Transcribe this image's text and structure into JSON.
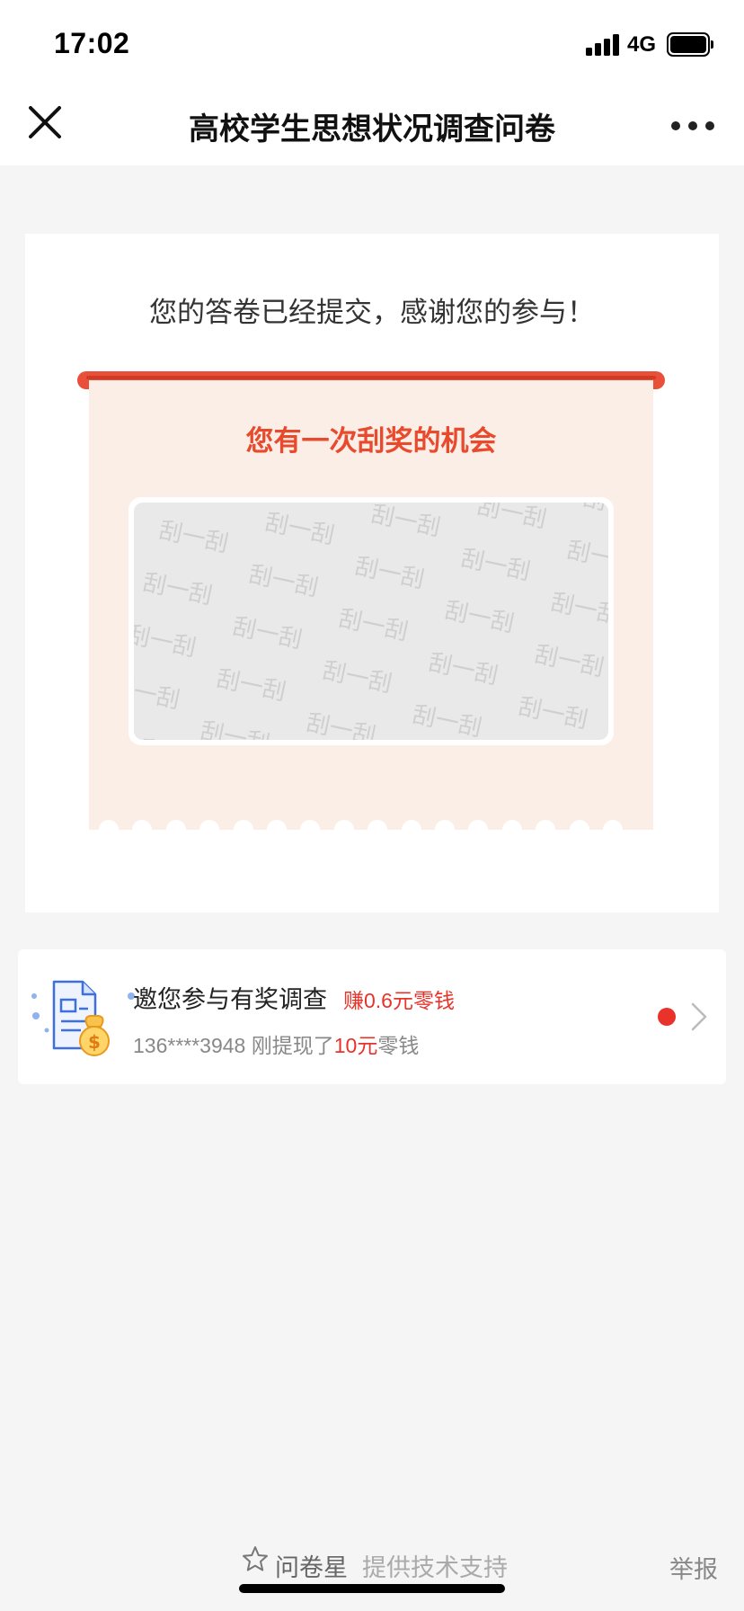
{
  "status_bar": {
    "time": "17:02",
    "network": "4G"
  },
  "nav": {
    "title": "高校学生思想状况调查问卷"
  },
  "result": {
    "thanks_text": "您的答卷已经提交，感谢您的参与！",
    "ticket_title": "您有一次刮奖的机会",
    "watermark_text": "刮一刮"
  },
  "promo": {
    "title": "邀您参与有奖调查",
    "earn": "赚0.6元零钱",
    "sub_prefix": "136****3948 刚提现了",
    "sub_amount": "10元",
    "sub_suffix": "零钱"
  },
  "footer": {
    "brand": "问卷星",
    "support": "提供技术支持",
    "report": "举报"
  },
  "colors": {
    "accent": "#e84a2d",
    "badge": "#e8322a",
    "ticket_bg": "#fbeee7"
  },
  "icons": [
    "close-icon",
    "more-icon",
    "signal-icon",
    "battery-icon",
    "survey-reward-icon",
    "chevron-right-icon",
    "star-icon"
  ]
}
